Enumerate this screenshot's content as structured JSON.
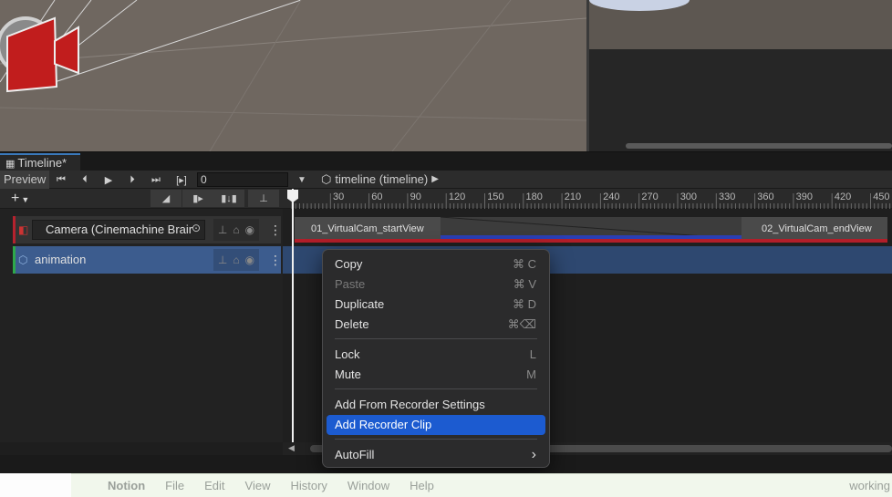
{
  "tabs": {
    "timeline": "Timeline*"
  },
  "toolbar": {
    "preview_label": "Preview",
    "frame_value": "0",
    "breadcrumb": "timeline (timeline)"
  },
  "ruler": {
    "ticks": [
      "30",
      "60",
      "90",
      "120",
      "150",
      "180",
      "210",
      "240",
      "270",
      "300",
      "330",
      "360",
      "390",
      "420",
      "450"
    ]
  },
  "tracks": {
    "camera_label": "Camera (Cinemachine Brair",
    "animation_label": "animation"
  },
  "clips": {
    "start_view": "01_VirtualCam_startView",
    "end_view": "02_VirtualCam_endView"
  },
  "context_menu": {
    "items": [
      {
        "label": "Copy",
        "shortcut": "⌘ C"
      },
      {
        "label": "Paste",
        "shortcut": "⌘ V"
      },
      {
        "label": "Duplicate",
        "shortcut": "⌘ D"
      },
      {
        "label": "Delete",
        "shortcut": "⌘⌫"
      },
      {
        "label": "Lock",
        "shortcut": "L"
      },
      {
        "label": "Mute",
        "shortcut": "M"
      },
      {
        "label": "Add From Recorder Settings",
        "shortcut": ""
      },
      {
        "label": "Add Recorder Clip",
        "shortcut": ""
      },
      {
        "label": "AutoFill",
        "shortcut": "›"
      }
    ]
  },
  "menubar": {
    "app": "Notion",
    "items": [
      "File",
      "Edit",
      "View",
      "History",
      "Window",
      "Help"
    ],
    "status": "working"
  },
  "colors": {
    "accent": "#1c5bd0",
    "camera_track": "#b5222e",
    "animation_track": "#2ea84a"
  }
}
